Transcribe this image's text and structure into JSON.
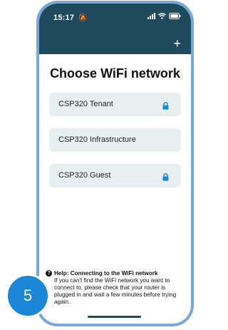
{
  "status_bar": {
    "time": "15:17",
    "dnd_icon": "bell-slash-icon",
    "signal_icon": "cellular-signal-icon",
    "wifi_icon": "wifi-icon",
    "battery_icon": "battery-icon"
  },
  "header": {
    "add_label": "+",
    "color": "#1f4a5c"
  },
  "title": "Choose WiFi network",
  "networks": [
    {
      "label": "CSP320 Tenant",
      "locked": true
    },
    {
      "label": "CSP320 Infrastructure",
      "locked": false
    },
    {
      "label": "CSP320 Guest",
      "locked": true
    }
  ],
  "help": {
    "icon": "question-circle-icon",
    "title": "Help: Connecting to the WiFi network",
    "body": "If you can't find the WiFi network you want to connect to, please check that your router is plugged in and wait a few minutes before trying again."
  },
  "step_badge": "5",
  "colors": {
    "accent": "#1b87d6",
    "frame": "#7aa8d6",
    "item_bg": "#e8eff1",
    "lock": "#1b87d6"
  }
}
